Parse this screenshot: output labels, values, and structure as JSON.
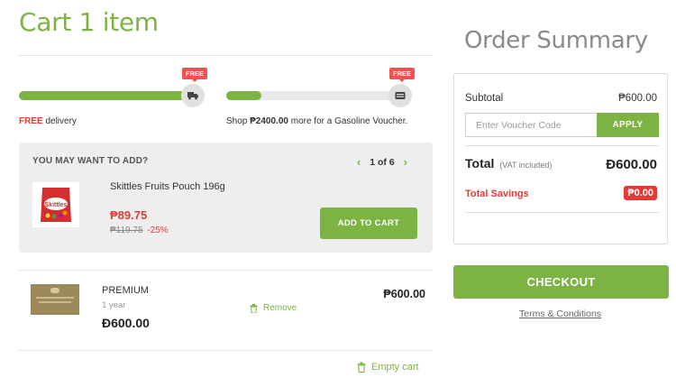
{
  "cart": {
    "title": "Cart 1 item"
  },
  "progress": {
    "delivery": {
      "badge": "FREE",
      "icon": "truck-icon",
      "fill_fraction": 0.96,
      "label_strong": "FREE",
      "label_rest": " delivery"
    },
    "voucher": {
      "badge": "FREE",
      "icon": "voucher-icon",
      "fill_fraction": 0.2,
      "label_prefix": "Shop ",
      "label_amount": "₱2400.00",
      "label_suffix": " more for a Gasoline Voucher."
    }
  },
  "upsell": {
    "title": "YOU MAY WANT TO ADD?",
    "pager_text": "1 of 6",
    "product": {
      "name": "Skittles Fruits Pouch 196g",
      "price": "₱89.75",
      "old_price": "₱119.75",
      "discount": "-25%",
      "button_label": "ADD TO CART"
    }
  },
  "cart_item": {
    "name": "PREMIUM",
    "term": "1 year",
    "price": "Ɖ600.00",
    "remove_label": "Remove",
    "total": "₱600.00"
  },
  "empty_cart_label": "Empty cart",
  "summary": {
    "title": "Order Summary",
    "subtotal_label": "Subtotal",
    "subtotal_value": "₱600.00",
    "voucher_placeholder": "Enter Voucher Code",
    "apply_label": "APPLY",
    "total_label": "Total",
    "vat_note": "(VAT included)",
    "total_value": "Ɖ600.00",
    "savings_label": "Total Savings",
    "savings_value": "₱0.00",
    "checkout_label": "CHECKOUT",
    "terms_label": "Terms & Conditions"
  },
  "colors": {
    "accent": "#7cb342",
    "alert": "#e53935",
    "muted": "#8a8a8a"
  }
}
